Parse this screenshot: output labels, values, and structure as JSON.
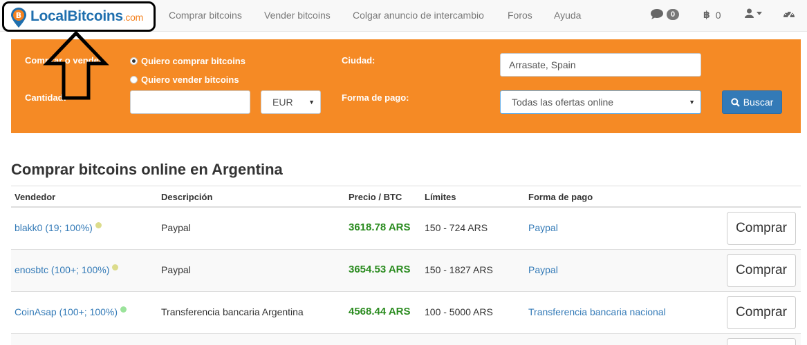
{
  "nav": {
    "logo_main": "LocalBitcoins",
    "logo_domain": ".com",
    "links": [
      "Comprar bitcoins",
      "Vender bitcoins",
      "Colgar anuncio de intercambio",
      "Foros",
      "Ayuda"
    ],
    "messages_count": "0",
    "btc_balance": "0",
    "icons": [
      "chat-icon",
      "bitcoin-icon",
      "user-icon",
      "caret-down-icon",
      "dashboard-icon"
    ]
  },
  "search": {
    "buy_sell_label": "Comprar o vender",
    "option_buy": "Quiero comprar bitcoins",
    "option_sell": "Quiero vender bitcoins",
    "selected_option": "buy",
    "amount_label": "Cantidad:",
    "amount_value": "",
    "currency": "EUR",
    "city_label": "Ciudad:",
    "city_value": "Arrasate, Spain",
    "payment_label": "Forma de pago:",
    "payment_value": "Todas las ofertas online",
    "search_button": "Buscar"
  },
  "listing": {
    "heading": "Comprar bitcoins online en Argentina",
    "columns": [
      "Vendedor",
      "Descripción",
      "Precio / BTC",
      "Límites",
      "Forma de pago"
    ],
    "rows": [
      {
        "seller": "blakk0 (19; 100%)",
        "status_color": "#dcdc8c",
        "description": "Paypal",
        "price": "3618.78 ARS",
        "limits": "150 - 724 ARS",
        "payment": "Paypal",
        "button": "Comprar"
      },
      {
        "seller": "enosbtc (100+; 100%)",
        "status_color": "#dcdc8c",
        "description": "Paypal",
        "price": "3654.53 ARS",
        "limits": "150 - 1827 ARS",
        "payment": "Paypal",
        "button": "Comprar"
      },
      {
        "seller": "CoinAsap (100+; 100%)",
        "status_color": "#9be39b",
        "description": "Transferencia bancaria Argentina",
        "price": "4568.44 ARS",
        "limits": "100 - 5000 ARS",
        "payment": "Transferencia bancaria nacional",
        "button": "Comprar"
      }
    ]
  },
  "colors": {
    "panel_bg": "#f58a25",
    "primary": "#337ab7",
    "price": "#2a8b1f",
    "logo_blue": "#1f6fae",
    "logo_orange": "#f58220"
  }
}
